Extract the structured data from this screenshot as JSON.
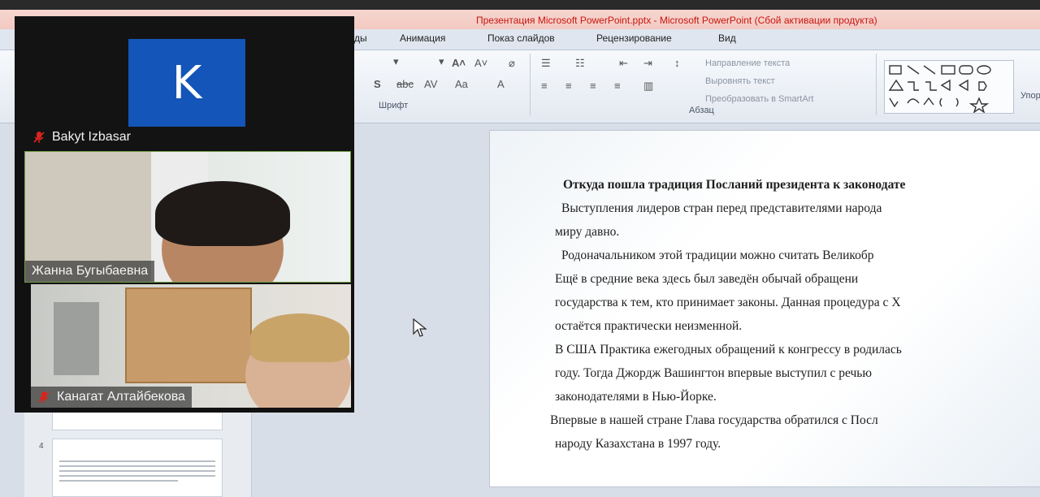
{
  "window": {
    "title": "Презентация Microsoft PowerPoint.pptx  -  Microsoft PowerPoint (Сбой активации продукта)"
  },
  "ribbon": {
    "tabs": [
      "ды",
      "Анимация",
      "Показ слайдов",
      "Рецензирование",
      "Вид"
    ],
    "groups": {
      "font": "Шрифт",
      "paragraph": "Абзац",
      "arrange_partial": "Упор"
    },
    "paragraph_commands": {
      "text_direction": "Направление текста",
      "align_text": "Выровнять текст",
      "smartart": "Преобразовать в SmartArt"
    }
  },
  "thumbnails": {
    "slide_number": "4"
  },
  "slide": {
    "heading": "Откуда пошла традиция Посланий президента к законодате",
    "lines": [
      "Выступления лидеров стран перед представителями народа",
      "миру давно.",
      "Родоначальником этой традиции можно считать Великобр",
      "Ещё в средние века здесь был заведён обычай обращени",
      "государства к тем, кто принимает законы. Данная процедура с Х",
      "остаётся практически неизменной.",
      "В США Практика ежегодных обращений к конгрессу в родилась",
      "году. Тогда Джордж Вашингтон впервые выступил с речью",
      "законодателями в Нью-Йорке.",
      "Впервые в нашей стране Глава государства обратился с Посл",
      "народу Казахстана в 1997 году."
    ]
  },
  "call": {
    "participants": [
      {
        "name": "Bakyt Izbasar",
        "avatar_letter": "K",
        "avatar_color": "#1355b8",
        "muted": true
      },
      {
        "name": "Жанна Бугыбаевна",
        "muted": false,
        "active_speaker": true
      },
      {
        "name": "Канагат Алтайбекова",
        "muted": true
      }
    ]
  },
  "colors": {
    "title_text": "#c8160f",
    "active_speaker_border": "#6e9a44",
    "mute_icon": "#d9251c"
  }
}
